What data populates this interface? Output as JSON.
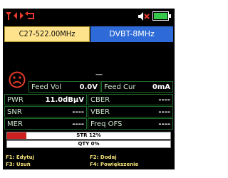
{
  "status": {
    "icons": [
      "antenna-icon",
      "arrows-icon",
      "back-icon",
      "mute-icon",
      "battery-icon"
    ],
    "colors": {
      "accent_red": "#e33a2a",
      "battery_green": "#35c84b"
    }
  },
  "channel": {
    "frequency": "C27-522.00MHz",
    "standard": "DVBT-8MHz"
  },
  "signal_status_icon": "sad-face-icon",
  "top_value": "----",
  "feed": {
    "vol_label": "Feed Vol",
    "vol_value": "0.0V",
    "cur_label": "Feed Cur",
    "cur_value": "0mA"
  },
  "measurements": {
    "pwr_label": "PWR",
    "pwr_value": "11.0dBμV",
    "cber_label": "CBER",
    "cber_value": "----",
    "snr_label": "SNR",
    "snr_value": "----",
    "vber_label": "VBER",
    "vber_value": "----",
    "mer_label": "MER",
    "mer_value": "----",
    "freqofs_label": "Freq OFS",
    "freqofs_value": "----"
  },
  "bars": {
    "str_label": "STR 12%",
    "str_level": 0.12,
    "qty_label": "QTY 0%",
    "qty_level": 0.0
  },
  "function_keys": {
    "f1": "F1: Edytuj",
    "f2": "F2: Dodaj",
    "f3": "F3: Usuń",
    "f4": "F4: Powiększenie"
  }
}
